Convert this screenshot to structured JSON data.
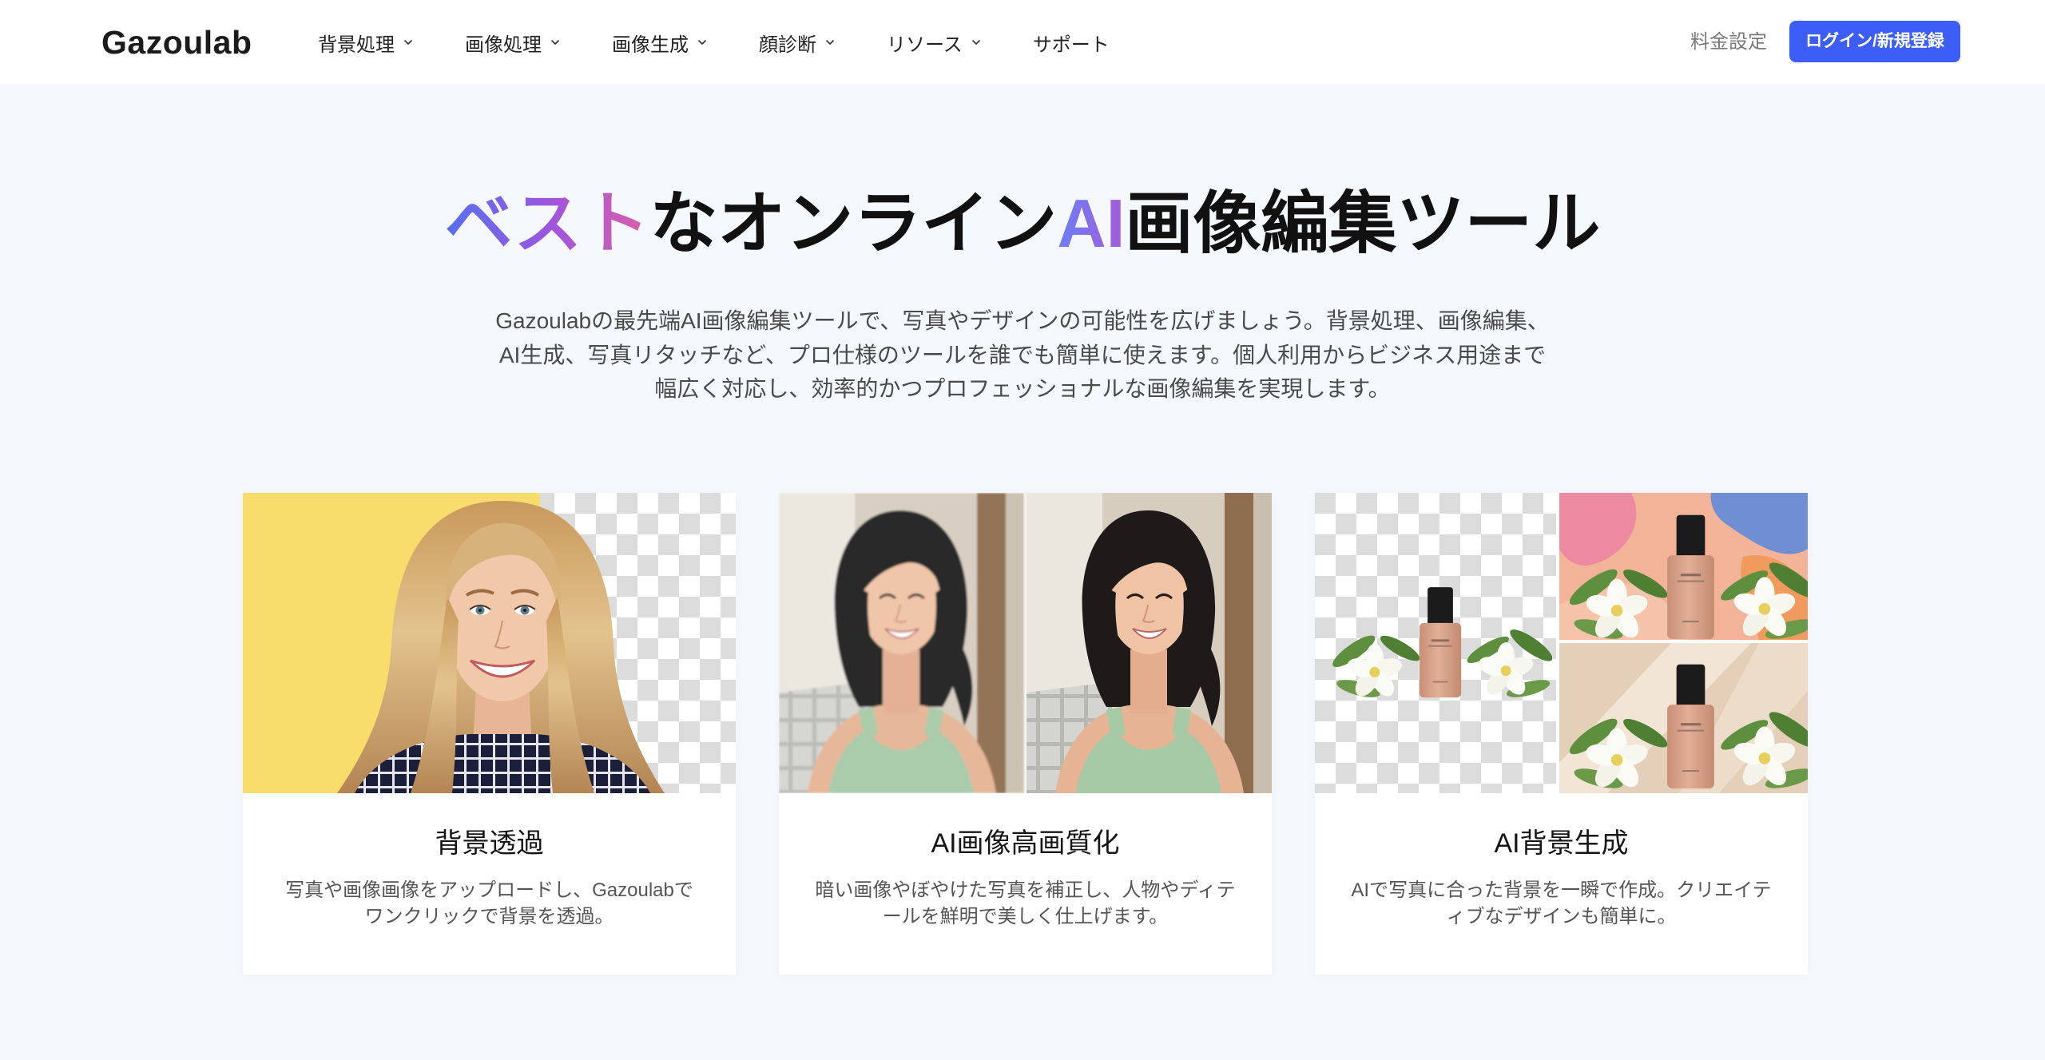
{
  "header": {
    "logo": "Gazoulab",
    "nav": [
      {
        "label": "背景処理",
        "icon": "chevron-down-icon"
      },
      {
        "label": "画像処理",
        "icon": "chevron-down-icon"
      },
      {
        "label": "画像生成",
        "icon": "chevron-down-icon"
      },
      {
        "label": "顔診断",
        "icon": "chevron-down-icon"
      },
      {
        "label": "リソース",
        "icon": "chevron-down-icon"
      },
      {
        "label": "サポート"
      }
    ],
    "pricing_link": "料金設定",
    "login_button": "ログイン/新規登録"
  },
  "hero": {
    "title": {
      "highlight_1": "ベスト",
      "text_1": "なオンライン",
      "highlight_2": "AI",
      "text_2": "画像編集ツール"
    },
    "description_lines": [
      "Gazoulabの最先端AI画像編集ツールで、写真やデザインの可能性を広げましょう。背景処理、画像編集、",
      "AI生成、写真リタッチなど、プロ仕様のツールを誰でも簡単に使えます。個人利用からビジネス用途まで",
      "幅広く対応し、効率的かつプロフェッショナルな画像編集を実現します。"
    ]
  },
  "cards": [
    {
      "title": "背景透過",
      "desc_lines": [
        "写真や画像画像をアップロードし、Gazoulabで",
        "ワンクリックで背景を透過。"
      ]
    },
    {
      "title": "AI画像高画質化",
      "desc_lines": [
        "暗い画像やぼやけた写真を補正し、人物やディテ",
        "ールを鮮明で美しく仕上げます。"
      ]
    },
    {
      "title": "AI背景生成",
      "desc_lines": [
        "AIで写真に合った背景を一瞬で作成。クリエイテ",
        "ィブなデザインも簡単に。"
      ]
    }
  ],
  "colors": {
    "accent": "#3d5ef6",
    "background": "#f5f8fd",
    "title_highlight_gradient": [
      "#5670f1",
      "#9c55df",
      "#dc5fa8"
    ],
    "ai_highlight_gradient": [
      "#6a80f7",
      "#a65ada"
    ]
  }
}
